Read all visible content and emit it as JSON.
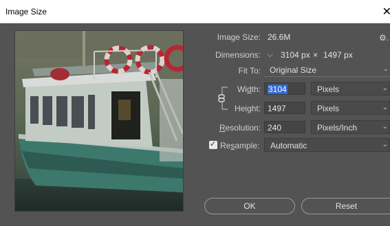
{
  "window": {
    "title": "Image Size",
    "close_icon": "close-icon"
  },
  "image_size": {
    "label": "Image Size:",
    "value": "26.6M"
  },
  "dimensions": {
    "label": "Dimensions:",
    "width": "3104 px",
    "times": "×",
    "height": "1497 px"
  },
  "fit_to": {
    "label": "Fit To:",
    "value": "Original Size"
  },
  "width": {
    "label_pre": "Wi",
    "label_u": "d",
    "label_post": "th:",
    "value": "3104",
    "unit": "Pixels"
  },
  "height": {
    "label_pre": "Hei",
    "label_u": "g",
    "label_post": "ht:",
    "value": "1497",
    "unit": "Pixels"
  },
  "resolution": {
    "label_u": "R",
    "label_post": "esolution:",
    "value": "240",
    "unit": "Pixels/Inch"
  },
  "resample": {
    "label_pre": "Re",
    "label_u": "s",
    "label_post": "ample:",
    "checked": true,
    "value": "Automatic"
  },
  "buttons": {
    "ok": "OK",
    "reset": "Reset"
  },
  "colors": {
    "dialog_bg": "#535353",
    "selection": "#2f6bd7"
  }
}
